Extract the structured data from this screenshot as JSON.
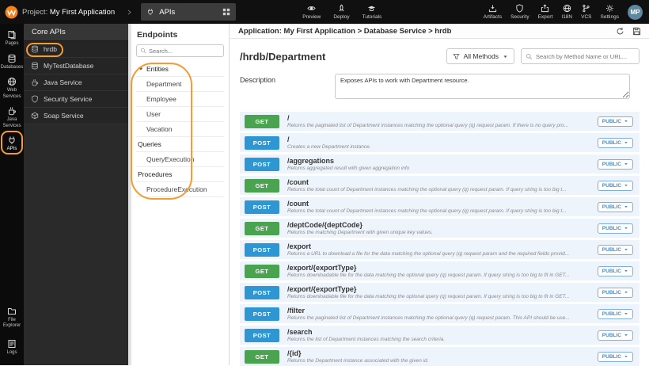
{
  "topbar": {
    "project_prefix": "Project:",
    "project_name": "My First Application",
    "workspace_label": "APIs",
    "actions": [
      {
        "label": "Preview",
        "icon": "eye"
      },
      {
        "label": "Deploy",
        "icon": "rocket"
      },
      {
        "label": "Tutorials",
        "icon": "grad-cap"
      }
    ],
    "right_actions": [
      {
        "label": "Artifacts",
        "icon": "tray-down"
      },
      {
        "label": "Security",
        "icon": "shield"
      },
      {
        "label": "Export",
        "icon": "share-up"
      },
      {
        "label": "I18N",
        "icon": "globe"
      },
      {
        "label": "VCS",
        "icon": "branch"
      },
      {
        "label": "Settings",
        "icon": "gear"
      }
    ],
    "avatar_initials": "MP"
  },
  "rail": {
    "items": [
      {
        "label": "Pages",
        "icon": "pages"
      },
      {
        "label": "Databases",
        "icon": "database"
      },
      {
        "label": "Web Services",
        "icon": "globe"
      },
      {
        "label": "Java Services",
        "icon": "java"
      },
      {
        "label": "APIs",
        "icon": "api-plug",
        "highlighted": true
      }
    ],
    "bottom_items": [
      {
        "label": "File Explorer",
        "icon": "folder"
      },
      {
        "label": "Logs",
        "icon": "logs"
      }
    ]
  },
  "core_panel": {
    "title": "Core APIs",
    "items": [
      {
        "label": "hrdb",
        "icon": "database",
        "highlighted": true
      },
      {
        "label": "MyTestDatabase",
        "icon": "database"
      },
      {
        "label": "Java Service",
        "icon": "java"
      },
      {
        "label": "Security Service",
        "icon": "shield"
      },
      {
        "label": "Soap Service",
        "icon": "cube"
      }
    ]
  },
  "endpoints_panel": {
    "title": "Endpoints",
    "search_placeholder": "Search...",
    "tree": [
      {
        "label": "Entities",
        "kind": "group",
        "icon": "caret-down"
      },
      {
        "label": "Department",
        "kind": "item"
      },
      {
        "label": "Employee",
        "kind": "item"
      },
      {
        "label": "User",
        "kind": "item"
      },
      {
        "label": "Vacation",
        "kind": "item"
      },
      {
        "label": "Queries",
        "kind": "header"
      },
      {
        "label": "QueryExecution",
        "kind": "item"
      },
      {
        "label": "Procedures",
        "kind": "header"
      },
      {
        "label": "ProcedureExecution",
        "kind": "item"
      }
    ]
  },
  "main": {
    "breadcrumb": "Application: My First Application > Database Service > hrdb",
    "title": "/hrdb/Department",
    "methods_filter_label": "All Methods",
    "search_placeholder": "Search by Method Name or URL...",
    "description_label": "Description",
    "description_value": "Exposes APIs to work with Department resource.",
    "endpoints": [
      {
        "method": "GET",
        "path": "/",
        "description": "Returns the paginated list of Department instances matching the optional query (q) request param. If there is no query pro...",
        "access": "PUBLIC"
      },
      {
        "method": "POST",
        "path": "/",
        "description": "Creates a new Department instance.",
        "access": "PUBLIC"
      },
      {
        "method": "POST",
        "path": "/aggregations",
        "description": "Returns aggregated result with given aggregation info",
        "access": "PUBLIC"
      },
      {
        "method": "GET",
        "path": "/count",
        "description": "Returns the total count of Department instances matching the optional query (q) request param. If query string is too big t...",
        "access": "PUBLIC"
      },
      {
        "method": "POST",
        "path": "/count",
        "description": "Returns the total count of Department instances matching the optional query (q) request param. If query string is too big t...",
        "access": "PUBLIC"
      },
      {
        "method": "GET",
        "path": "/deptCode/{deptCode}",
        "description": "Returns the matching Department with given unique key values.",
        "access": "PUBLIC"
      },
      {
        "method": "POST",
        "path": "/export",
        "description": "Returns a URL to download a file for the data matching the optional query (q) request param and the required fields provid...",
        "access": "PUBLIC"
      },
      {
        "method": "GET",
        "path": "/export/{exportType}",
        "description": "Returns downloadable file for the data matching the optional query (q) request param. If query string is too big to fit in GET...",
        "access": "PUBLIC"
      },
      {
        "method": "POST",
        "path": "/export/{exportType}",
        "description": "Returns downloadable file for the data matching the optional query (q) request param. If query string is too big to fit in GET...",
        "access": "PUBLIC"
      },
      {
        "method": "POST",
        "path": "/filter",
        "description": "Returns the paginated list of Department instances matching the optional query (q) request param. This API should be use...",
        "access": "PUBLIC"
      },
      {
        "method": "POST",
        "path": "/search",
        "description": "Returns the list of Department instances matching the search criteria.",
        "access": "PUBLIC"
      },
      {
        "method": "GET",
        "path": "/{id}",
        "description": "Returns the Department instance associated with the given id.",
        "access": "PUBLIC"
      }
    ]
  },
  "colors": {
    "annotation": "#f59b31",
    "method_get": "#4aa34e",
    "method_post": "#2e96d2",
    "access_badge": "#3f8fd1",
    "row_background": "#eef4fb"
  }
}
